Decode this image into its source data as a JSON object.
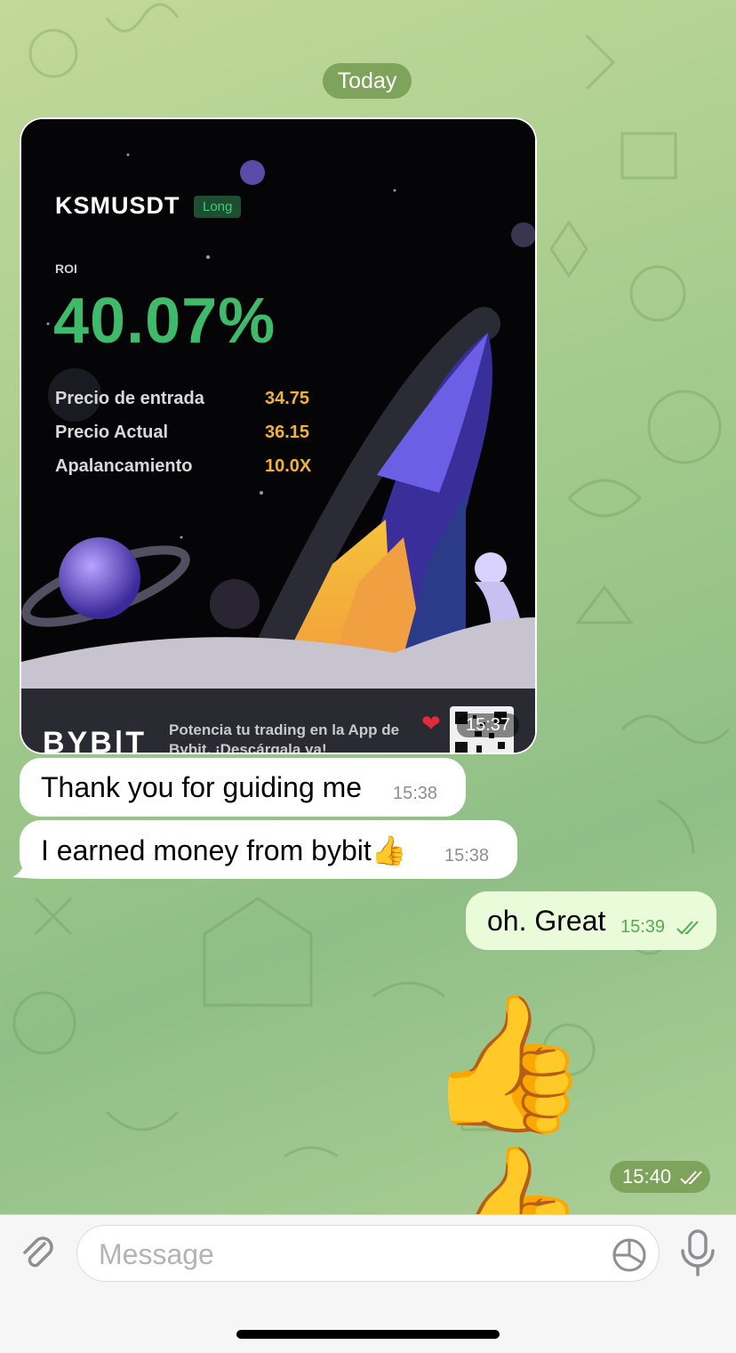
{
  "chat": {
    "date_label": "Today",
    "image_card": {
      "pair": "KSMUSDT",
      "side": "Long",
      "roi_label": "ROI",
      "roi_value": "40.07%",
      "rows": [
        {
          "label": "Precio de entrada",
          "value": "34.75"
        },
        {
          "label": "Precio Actual",
          "value": "36.15"
        },
        {
          "label": "Apalancamiento",
          "value": "10.0X"
        }
      ],
      "brand": "BYB|T",
      "promo": "Potencia tu trading en la App de Bybit. ¡Descárgala ya!",
      "reaction": "❤",
      "time": "15:37"
    },
    "messages": [
      {
        "text": "Thank you for guiding me",
        "time": "15:38",
        "direction": "in"
      },
      {
        "text": "I earned money from bybit👍",
        "time": "15:38",
        "direction": "in"
      },
      {
        "text": "oh. Great",
        "time": "15:39",
        "direction": "out",
        "status": "read"
      }
    ],
    "emoji_message": {
      "text": "👍👍",
      "time": "15:40"
    }
  },
  "input": {
    "placeholder": "Message"
  },
  "colors": {
    "out_bubble": "#e9fbd8",
    "in_bubble": "#ffffff",
    "date_pill": "#7ea35a",
    "roi_green": "#3fb96a",
    "value_orange": "#f2b23a"
  }
}
